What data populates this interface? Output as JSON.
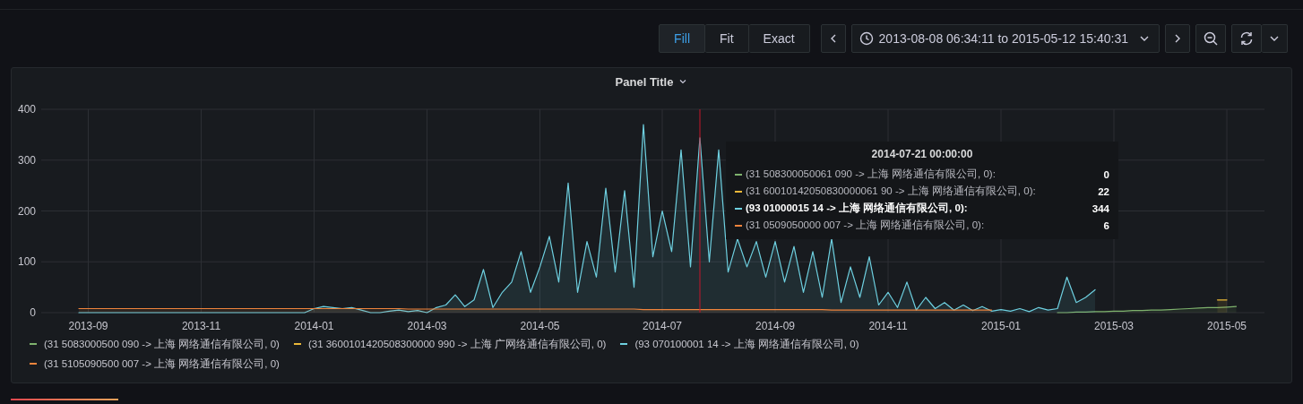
{
  "toolbar": {
    "zoom_modes": [
      {
        "label": "Fill",
        "selected": true
      },
      {
        "label": "Fit",
        "selected": false
      },
      {
        "label": "Exact",
        "selected": false
      }
    ],
    "time_range": "2013-08-08 06:34:11 to 2015-05-12 15:40:31"
  },
  "panel": {
    "title": "Panel Title",
    "chart_data": {
      "type": "area",
      "grid": true,
      "ylim": [
        0,
        400
      ],
      "yticks": [
        0,
        100,
        200,
        300,
        400
      ],
      "categories": [
        null,
        "2013-09",
        null,
        null,
        null,
        null,
        null,
        null,
        null,
        null,
        null,
        null,
        null,
        "2013-11",
        null,
        null,
        null,
        null,
        null,
        null,
        null,
        null,
        null,
        null,
        null,
        "2014-01",
        null,
        null,
        null,
        null,
        null,
        null,
        null,
        null,
        null,
        null,
        null,
        "2014-03",
        null,
        null,
        null,
        null,
        null,
        null,
        null,
        null,
        null,
        null,
        null,
        "2014-05",
        null,
        null,
        null,
        null,
        null,
        null,
        null,
        null,
        null,
        null,
        null,
        null,
        "2014-07",
        null,
        null,
        null,
        null,
        null,
        null,
        null,
        null,
        null,
        null,
        null,
        "2014-09",
        null,
        null,
        null,
        null,
        null,
        null,
        null,
        null,
        null,
        null,
        null,
        "2014-11",
        null,
        null,
        null,
        null,
        null,
        null,
        null,
        null,
        null,
        null,
        null,
        "2015-01",
        null,
        null,
        null,
        null,
        null,
        null,
        null,
        null,
        null,
        null,
        null,
        "2015-03",
        null,
        null,
        null,
        null,
        null,
        null,
        null,
        null,
        null,
        null,
        null,
        "2015-05",
        null
      ],
      "series": [
        {
          "name": "(31 5083000500 090 -> 上海 网络通信有限公司, 0)",
          "color": "#7eb26d",
          "values": [
            null,
            null,
            null,
            null,
            null,
            null,
            null,
            null,
            null,
            null,
            null,
            null,
            null,
            null,
            null,
            null,
            null,
            null,
            null,
            null,
            null,
            null,
            null,
            null,
            null,
            null,
            null,
            null,
            null,
            null,
            null,
            null,
            null,
            null,
            null,
            null,
            null,
            null,
            null,
            null,
            null,
            null,
            null,
            null,
            null,
            null,
            null,
            null,
            null,
            null,
            null,
            null,
            null,
            null,
            null,
            null,
            null,
            null,
            null,
            null,
            null,
            null,
            null,
            null,
            null,
            null,
            null,
            null,
            null,
            null,
            null,
            null,
            null,
            null,
            null,
            null,
            null,
            null,
            null,
            null,
            null,
            null,
            null,
            null,
            null,
            null,
            null,
            null,
            null,
            null,
            null,
            null,
            null,
            null,
            null,
            null,
            null,
            null,
            null,
            null,
            null,
            null,
            null,
            null,
            0,
            0,
            1,
            1,
            2,
            2,
            3,
            3,
            4,
            4,
            5,
            5,
            6,
            7,
            8,
            9,
            10,
            10,
            11,
            12
          ]
        },
        {
          "name": "(31 3600101420508300000 990 -> 上海 广网络通信有限公司, 0)",
          "color": "#eab839",
          "values": [
            null,
            null,
            null,
            null,
            null,
            null,
            null,
            null,
            null,
            null,
            null,
            null,
            null,
            null,
            null,
            null,
            null,
            null,
            null,
            null,
            null,
            null,
            null,
            null,
            null,
            null,
            null,
            null,
            null,
            null,
            null,
            null,
            null,
            null,
            null,
            null,
            null,
            null,
            null,
            null,
            null,
            null,
            null,
            null,
            null,
            null,
            null,
            null,
            null,
            null,
            null,
            null,
            null,
            null,
            null,
            null,
            null,
            null,
            null,
            null,
            null,
            null,
            null,
            null,
            null,
            null,
            null,
            null,
            null,
            null,
            null,
            null,
            null,
            null,
            null,
            null,
            null,
            null,
            null,
            null,
            null,
            null,
            null,
            null,
            null,
            null,
            null,
            null,
            null,
            null,
            null,
            null,
            null,
            null,
            null,
            null,
            null,
            null,
            null,
            null,
            null,
            null,
            null,
            null,
            null,
            null,
            null,
            null,
            null,
            null,
            null,
            null,
            null,
            null,
            null,
            null,
            null,
            null,
            null,
            null,
            null,
            25,
            25,
            null
          ]
        },
        {
          "name": "(93 070100001 14 -> 上海 网络通信有限公司, 0)",
          "color": "#6ed0e0",
          "values": [
            0,
            0,
            0,
            0,
            0,
            0,
            0,
            0,
            0,
            0,
            0,
            0,
            0,
            0,
            0,
            0,
            0,
            0,
            0,
            0,
            0,
            0,
            0,
            0,
            0,
            8,
            12,
            10,
            8,
            10,
            5,
            0,
            0,
            3,
            5,
            2,
            4,
            0,
            10,
            15,
            35,
            12,
            25,
            85,
            10,
            40,
            60,
            120,
            40,
            90,
            150,
            60,
            255,
            40,
            140,
            70,
            245,
            80,
            240,
            50,
            370,
            110,
            200,
            120,
            320,
            90,
            344,
            100,
            320,
            80,
            145,
            90,
            140,
            70,
            140,
            60,
            130,
            40,
            120,
            30,
            145,
            20,
            90,
            30,
            110,
            15,
            40,
            10,
            60,
            5,
            30,
            8,
            20,
            5,
            15,
            4,
            12,
            3,
            6,
            3,
            8,
            2,
            10,
            5,
            8,
            70,
            20,
            30,
            45,
            null,
            null,
            null,
            null,
            null,
            null,
            null,
            null,
            null,
            null,
            null,
            null,
            null,
            null,
            null
          ]
        },
        {
          "name": "(31 5105090500 007 -> 上海 网络通信有限公司, 0)",
          "color": "#ef843c",
          "values": [
            8,
            8,
            8,
            8,
            8,
            8,
            8,
            8,
            8,
            8,
            8,
            8,
            8,
            8,
            8,
            8,
            8,
            8,
            8,
            8,
            8,
            8,
            8,
            8,
            8,
            8,
            8,
            8,
            8,
            8,
            8,
            8,
            8,
            8,
            8,
            7,
            7,
            7,
            7,
            7,
            7,
            7,
            7,
            7,
            7,
            7,
            7,
            7,
            7,
            7,
            7,
            7,
            7,
            7,
            7,
            7,
            7,
            7,
            7,
            7,
            6,
            6,
            6,
            6,
            6,
            6,
            6,
            6,
            6,
            6,
            6,
            6,
            6,
            6,
            6,
            6,
            6,
            6,
            6,
            6,
            5,
            5,
            5,
            5,
            5,
            5,
            5,
            5,
            5,
            5,
            5,
            5,
            5,
            5,
            5,
            5,
            5,
            5,
            null,
            null,
            null,
            null,
            null,
            null,
            null,
            null,
            null,
            null,
            null,
            null,
            null,
            null,
            null,
            null,
            null,
            null,
            null,
            null,
            null,
            null,
            null,
            null,
            null,
            null
          ]
        }
      ]
    },
    "tooltip": {
      "time": "2014-07-21 00:00:00",
      "rows": [
        {
          "label": "(31 508300050061 090 -> 上海 网络通信有限公司, 0):",
          "value": "0",
          "highlighted": false
        },
        {
          "label": "(31 60010142050830000061 90 -> 上海 网络通信有限公司, 0):",
          "value": "22",
          "highlighted": false
        },
        {
          "label": "(93 01000015 14 -> 上海 网络通信有限公司, 0):",
          "value": "344",
          "highlighted": true
        },
        {
          "label": "(31 0509050000 007 -> 上海 网络通信有限公司, 0):",
          "value": "6",
          "highlighted": false
        }
      ]
    }
  }
}
